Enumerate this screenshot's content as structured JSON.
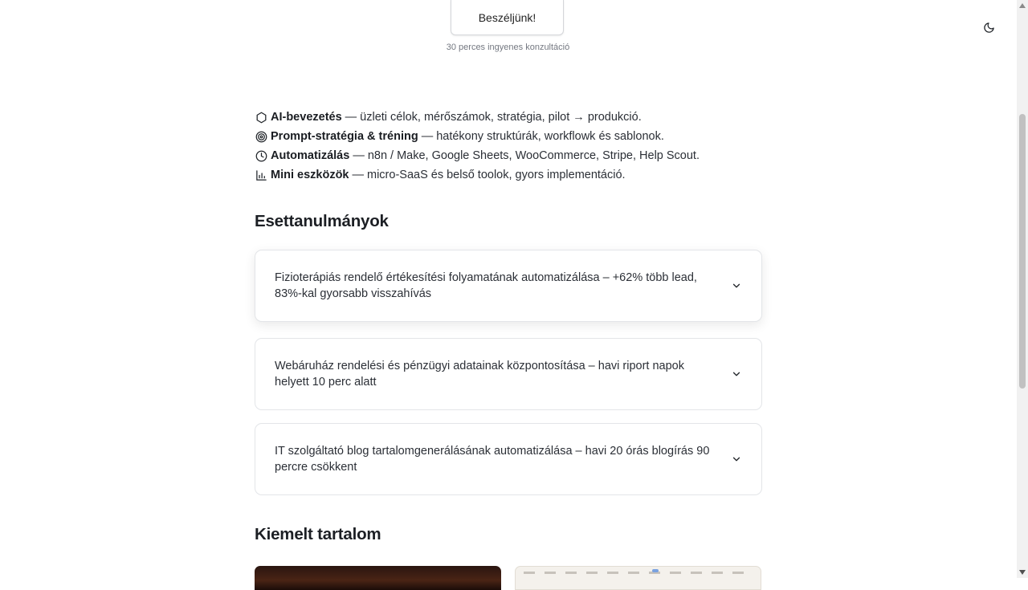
{
  "cta": {
    "button_label": "Beszéljünk!",
    "note": "30 perces ingyenes konzultáció"
  },
  "theme_toggle": {
    "icon": "moon-icon"
  },
  "services": [
    {
      "icon": "hexagon-icon",
      "title": "AI-bevezetés",
      "separator": "—",
      "description": "üzleti célok, mérőszámok, stratégia, pilot → produkció."
    },
    {
      "icon": "target-icon",
      "title": "Prompt-stratégia & tréning",
      "separator": "—",
      "description": "hatékony struktúrák, workflowk és sablonok."
    },
    {
      "icon": "clock-icon",
      "title": "Automatizálás",
      "separator": "—",
      "description": "n8n / Make, Google Sheets, WooCommerce, Stripe, Help Scout."
    },
    {
      "icon": "bar-chart-icon",
      "title": "Mini eszközök",
      "separator": "—",
      "description": "micro-SaaS és belső toolok, gyors implementáció."
    }
  ],
  "case_studies": {
    "heading": "Esettanulmányok",
    "items": [
      {
        "title": "Fizioterápiás rendelő értékesítési folyamatának automatizálása – +62% több lead, 83%-kal gyorsabb visszahívás",
        "icon": "chevron-down-icon"
      },
      {
        "title": "Webáruház rendelési és pénzügyi adatainak központosítása – havi riport napok helyett 10 perc alatt",
        "icon": "chevron-down-icon"
      },
      {
        "title": "IT szolgáltató blog tartalomgenerálásának automatizálása – havi 20 órás blogírás 90 percre csökkent",
        "icon": "chevron-down-icon"
      }
    ]
  },
  "featured": {
    "heading": "Kiemelt tartalom"
  },
  "colors": {
    "text": "#1f2328",
    "border": "#e3e5e8",
    "muted": "#747881",
    "scrollbar_track": "#f1f1f1",
    "scrollbar_thumb": "#c1c1c1"
  }
}
